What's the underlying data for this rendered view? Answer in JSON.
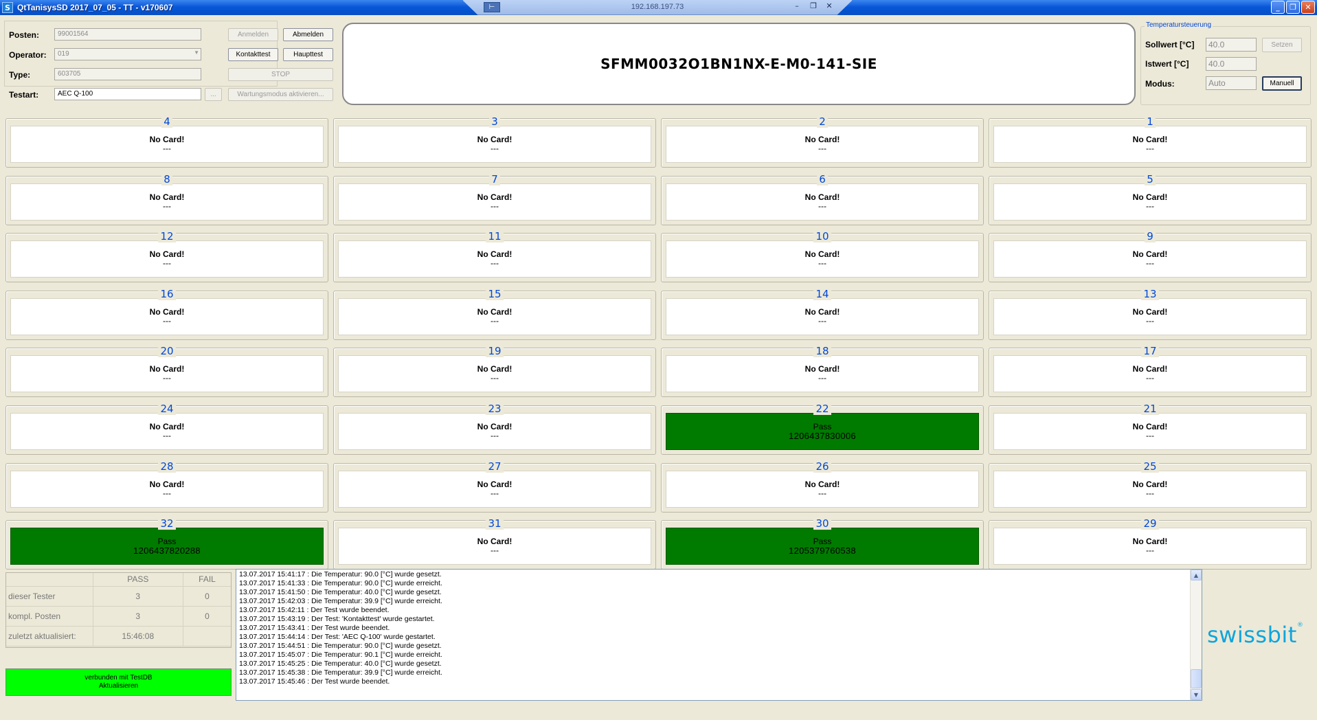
{
  "window": {
    "title": "QtTanisysSD 2017_07_05 - TT - v170607",
    "icon_letter": "S",
    "remote_ip": "192.168.197.73",
    "rdp_icons": [
      "pin-icon",
      "minimize-icon",
      "restore-icon",
      "close-icon"
    ],
    "buttons": {
      "minimize": "_",
      "maximize": "❐",
      "close": "✕"
    }
  },
  "form": {
    "posten_label": "Posten:",
    "posten_value": "99001564",
    "operator_label": "Operator:",
    "operator_value": "019",
    "type_label": "Type:",
    "type_value": "603705",
    "testart_label": "Testart:",
    "testart_value": "AEC Q-100",
    "browse_label": "...",
    "anmelden": "Anmelden",
    "abmelden": "Abmelden",
    "kontakttest": "Kontakttest",
    "haupttest": "Haupttest",
    "stop": "STOP",
    "wartung": "Wartungsmodus aktivieren..."
  },
  "serial": "SFMM0032O1BN1NX-E-M0-141-SIE",
  "temperature": {
    "group_title": "Temperatursteuerung",
    "sollwert_label": "Sollwert [°C]",
    "sollwert_value": "40.0",
    "setzen": "Setzen",
    "istwert_label": "Istwert [°C]",
    "istwert_value": "40.0",
    "modus_label": "Modus:",
    "modus_value": "Auto",
    "manuell": "Manuell"
  },
  "slots": [
    {
      "num": "4",
      "line1": "No Card!",
      "line2": "---",
      "status": "empty"
    },
    {
      "num": "3",
      "line1": "No Card!",
      "line2": "---",
      "status": "empty"
    },
    {
      "num": "2",
      "line1": "No Card!",
      "line2": "---",
      "status": "empty"
    },
    {
      "num": "1",
      "line1": "No Card!",
      "line2": "---",
      "status": "empty"
    },
    {
      "num": "8",
      "line1": "No Card!",
      "line2": "---",
      "status": "empty"
    },
    {
      "num": "7",
      "line1": "No Card!",
      "line2": "---",
      "status": "empty"
    },
    {
      "num": "6",
      "line1": "No Card!",
      "line2": "---",
      "status": "empty"
    },
    {
      "num": "5",
      "line1": "No Card!",
      "line2": "---",
      "status": "empty"
    },
    {
      "num": "12",
      "line1": "No Card!",
      "line2": "---",
      "status": "empty"
    },
    {
      "num": "11",
      "line1": "No Card!",
      "line2": "---",
      "status": "empty"
    },
    {
      "num": "10",
      "line1": "No Card!",
      "line2": "---",
      "status": "empty"
    },
    {
      "num": "9",
      "line1": "No Card!",
      "line2": "---",
      "status": "empty"
    },
    {
      "num": "16",
      "line1": "No Card!",
      "line2": "---",
      "status": "empty"
    },
    {
      "num": "15",
      "line1": "No Card!",
      "line2": "---",
      "status": "empty"
    },
    {
      "num": "14",
      "line1": "No Card!",
      "line2": "---",
      "status": "empty"
    },
    {
      "num": "13",
      "line1": "No Card!",
      "line2": "---",
      "status": "empty"
    },
    {
      "num": "20",
      "line1": "No Card!",
      "line2": "---",
      "status": "empty"
    },
    {
      "num": "19",
      "line1": "No Card!",
      "line2": "---",
      "status": "empty"
    },
    {
      "num": "18",
      "line1": "No Card!",
      "line2": "---",
      "status": "empty"
    },
    {
      "num": "17",
      "line1": "No Card!",
      "line2": "---",
      "status": "empty"
    },
    {
      "num": "24",
      "line1": "No Card!",
      "line2": "---",
      "status": "empty"
    },
    {
      "num": "23",
      "line1": "No Card!",
      "line2": "---",
      "status": "empty"
    },
    {
      "num": "22",
      "line1": "Pass",
      "line2": "1206437830006",
      "status": "pass"
    },
    {
      "num": "21",
      "line1": "No Card!",
      "line2": "---",
      "status": "empty"
    },
    {
      "num": "28",
      "line1": "No Card!",
      "line2": "---",
      "status": "empty"
    },
    {
      "num": "27",
      "line1": "No Card!",
      "line2": "---",
      "status": "empty"
    },
    {
      "num": "26",
      "line1": "No Card!",
      "line2": "---",
      "status": "empty"
    },
    {
      "num": "25",
      "line1": "No Card!",
      "line2": "---",
      "status": "empty"
    },
    {
      "num": "32",
      "line1": "Pass",
      "line2": "1206437820288",
      "status": "pass"
    },
    {
      "num": "31",
      "line1": "No Card!",
      "line2": "---",
      "status": "empty"
    },
    {
      "num": "30",
      "line1": "Pass",
      "line2": "1205379760538",
      "status": "pass"
    },
    {
      "num": "29",
      "line1": "No Card!",
      "line2": "---",
      "status": "empty"
    }
  ],
  "stats": {
    "col_pass": "PASS",
    "col_fail": "FAIL",
    "row1_label": "dieser Tester",
    "row1_pass": "3",
    "row1_fail": "0",
    "row2_label": "kompl. Posten",
    "row2_pass": "3",
    "row2_fail": "0",
    "row3_label": "zuletzt aktualisiert:",
    "row3_value": "15:46:08"
  },
  "db_status": {
    "line1": "verbunden mit TestDB",
    "line2": "Aktualisieren"
  },
  "log": [
    "13.07.2017 15:41:17 : Die Temperatur: 90.0 [°C] wurde gesetzt.",
    "13.07.2017 15:41:33 : Die Temperatur: 90.0 [°C] wurde erreicht.",
    "13.07.2017 15:41:50 : Die Temperatur: 40.0 [°C] wurde gesetzt.",
    "13.07.2017 15:42:03 : Die Temperatur: 39.9 [°C] wurde erreicht.",
    "13.07.2017 15:42:11 : Der Test wurde beendet.",
    "13.07.2017 15:43:19 : Der Test: 'Kontakttest' wurde gestartet.",
    "13.07.2017 15:43:41 : Der Test wurde beendet.",
    "13.07.2017 15:44:14 : Der Test: 'AEC Q-100' wurde gestartet.",
    "13.07.2017 15:44:51 : Die Temperatur: 90.0 [°C] wurde gesetzt.",
    "13.07.2017 15:45:07 : Die Temperatur: 90.1 [°C] wurde erreicht.",
    "13.07.2017 15:45:25 : Die Temperatur: 40.0 [°C] wurde gesetzt.",
    "13.07.2017 15:45:38 : Die Temperatur: 39.9 [°C] wurde erreicht.",
    "13.07.2017 15:45:46 : Der Test wurde beendet."
  ],
  "logo": {
    "text": "swissbit",
    "mark": "®",
    "color": "#0ea5dc"
  },
  "colors": {
    "pass": "#007b00",
    "db_ok": "#00ff00",
    "slot_number": "#0048d8",
    "titlebar": "#0453cf"
  }
}
